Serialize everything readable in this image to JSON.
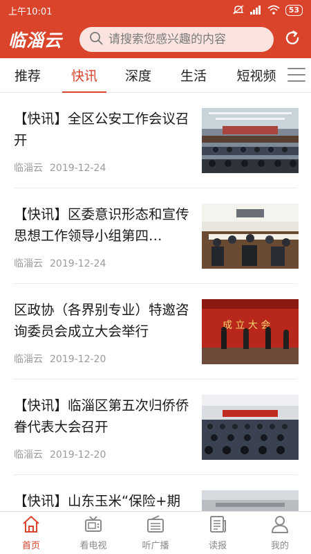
{
  "status_bar": {
    "time": "上午10:01",
    "battery": "53",
    "network": "4G"
  },
  "header": {
    "logo_text": "临淄云",
    "search_placeholder": "请搜索您感兴趣的内容",
    "refresh_icon": "refresh-icon"
  },
  "tabs": [
    {
      "label": "推荐",
      "active": false
    },
    {
      "label": "快讯",
      "active": true
    },
    {
      "label": "深度",
      "active": false
    },
    {
      "label": "生活",
      "active": false
    },
    {
      "label": "短视频",
      "active": false
    }
  ],
  "news": [
    {
      "title": "【快讯】全区公安工作会议召开",
      "source": "临淄云",
      "date": "2019-12-24"
    },
    {
      "title": "【快讯】区委意识形态和宣传思想工作领导小组第四…",
      "source": "临淄云",
      "date": "2019-12-24"
    },
    {
      "title": "区政协（各界别专业）特邀咨询委员会成立大会举行",
      "source": "临淄云",
      "date": "2019-12-20"
    },
    {
      "title": "【快讯】临淄区第五次归侨侨眷代表大会召开",
      "source": "临淄云",
      "date": "2019-12-20"
    },
    {
      "title": "【快讯】山东玉米“保险+期",
      "source": "",
      "date": ""
    }
  ],
  "bottom_nav": [
    {
      "label": "首页",
      "icon": "home-icon",
      "active": true
    },
    {
      "label": "看电视",
      "icon": "tv-icon",
      "active": false
    },
    {
      "label": "听广播",
      "icon": "radio-icon",
      "active": false
    },
    {
      "label": "读报",
      "icon": "newspaper-icon",
      "active": false
    },
    {
      "label": "我的",
      "icon": "profile-icon",
      "active": false
    }
  ],
  "colors": {
    "brand_red": "#d9442b",
    "search_bg": "#fbe4df",
    "meta_gray": "#9a9a9a",
    "nav_gray": "#8a8a8a"
  }
}
